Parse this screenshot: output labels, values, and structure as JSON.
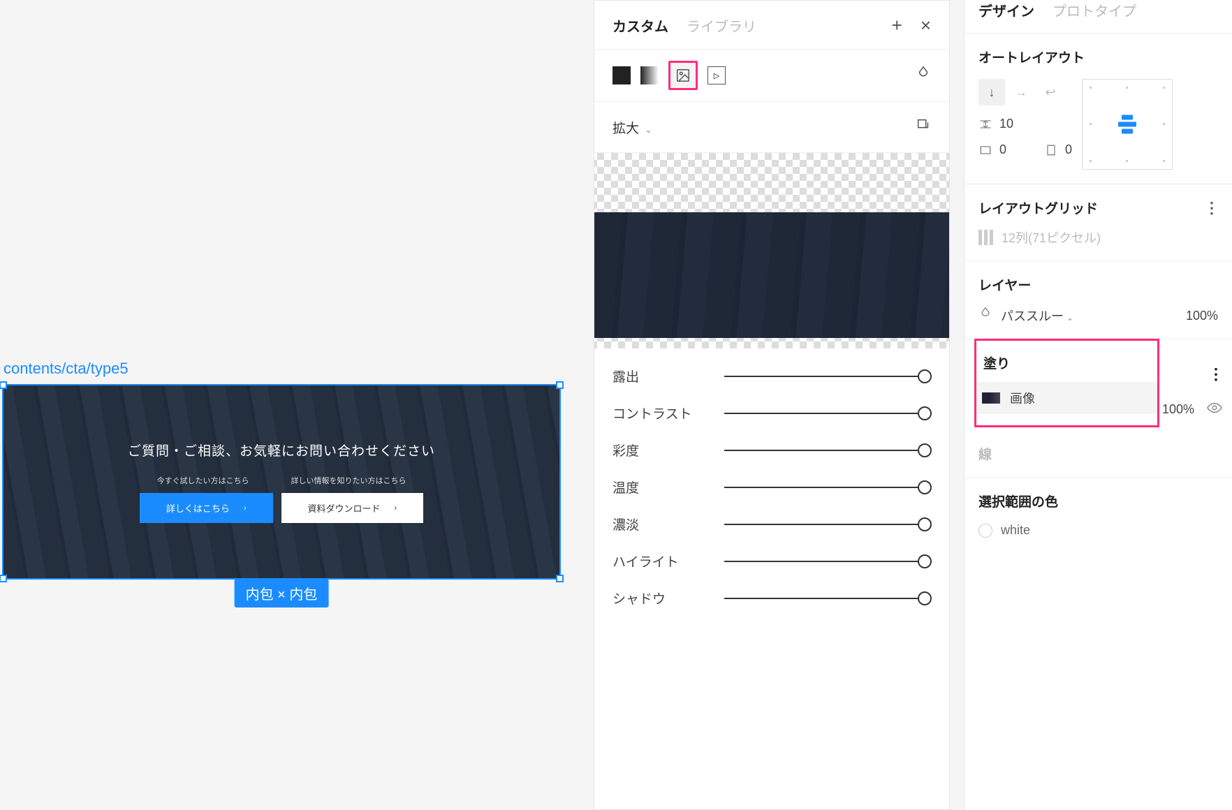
{
  "canvas": {
    "frame_label": "contents/cta/type5",
    "heading": "ご質問・ご相談、お気軽にお問い合わせください",
    "sub_left": "今すぐ試したい方はこちら",
    "sub_right": "詳しい情報を知りたい方はこちら",
    "btn_primary": "詳しくはこちら",
    "btn_secondary": "資料ダウンロード",
    "size_badge": "内包 × 内包"
  },
  "popover": {
    "tab_custom": "カスタム",
    "tab_library": "ライブラリ",
    "scale_mode": "拡大",
    "sliders": {
      "exposure": "露出",
      "contrast": "コントラスト",
      "saturation": "彩度",
      "temperature": "温度",
      "tint": "濃淡",
      "highlights": "ハイライト",
      "shadows": "シャドウ"
    }
  },
  "inspector": {
    "tab_design": "デザイン",
    "tab_prototype": "プロトタイプ",
    "autolayout": {
      "title": "オートレイアウト",
      "spacing": "10",
      "pad_h": "0",
      "pad_v": "0"
    },
    "grid": {
      "title": "レイアウトグリッド",
      "desc": "12列(71ピクセル)"
    },
    "layer": {
      "title": "レイヤー",
      "mode": "パススルー",
      "opacity": "100%"
    },
    "fill": {
      "title": "塗り",
      "label": "画像",
      "opacity": "100%"
    },
    "stroke": {
      "title": "線"
    },
    "selection_colors": {
      "title": "選択範囲の色",
      "white": "white"
    }
  }
}
